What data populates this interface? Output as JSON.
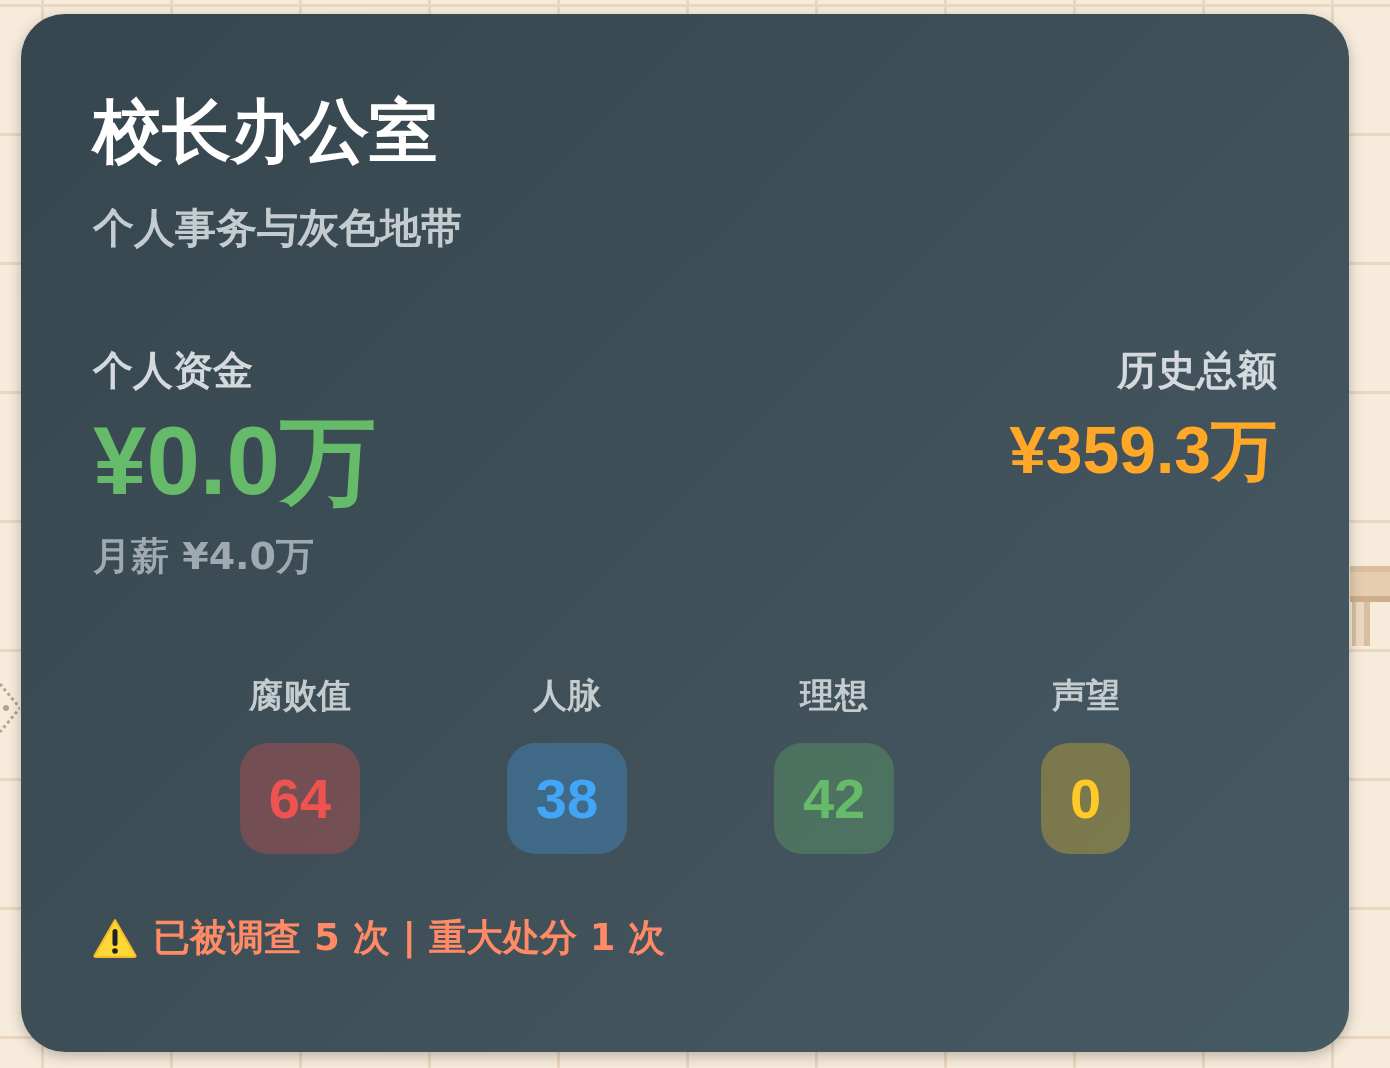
{
  "header": {
    "title": "校长办公室",
    "subtitle": "个人事务与灰色地带"
  },
  "funds": {
    "label": "个人资金",
    "value": "¥0.0万",
    "salary": "月薪 ¥4.0万"
  },
  "history": {
    "label": "历史总额",
    "value": "¥359.3万"
  },
  "stats": [
    {
      "label": "腐败值",
      "value": "64",
      "color": "#ef5350"
    },
    {
      "label": "人脉",
      "value": "38",
      "color": "#42a5f5"
    },
    {
      "label": "理想",
      "value": "42",
      "color": "#66bb6a"
    },
    {
      "label": "声望",
      "value": "0",
      "color": "#ffca28"
    }
  ],
  "warning": {
    "text": "已被调查 5 次 | 重大处分 1 次"
  }
}
